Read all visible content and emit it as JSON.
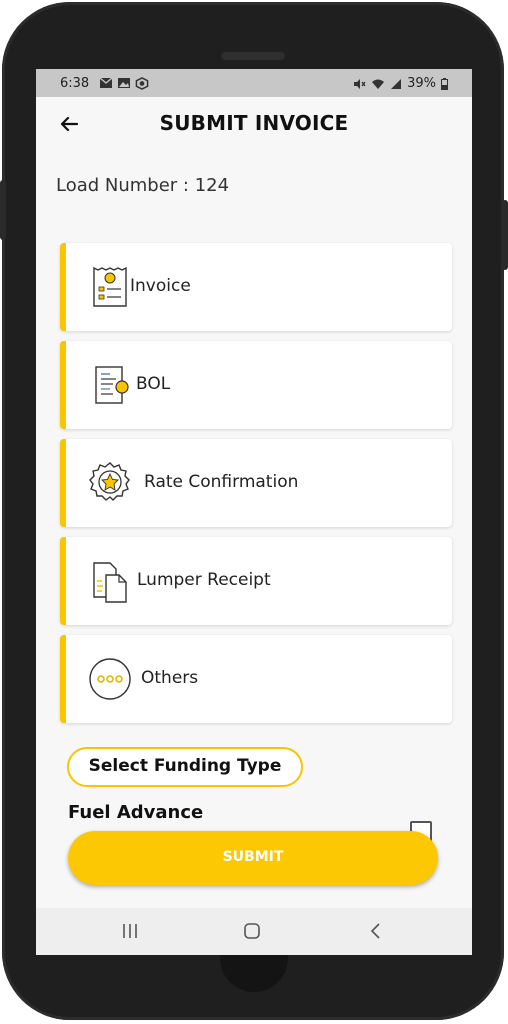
{
  "status_bar": {
    "time": "6:38",
    "battery": "39%",
    "left_icons": [
      "mail-icon",
      "image-icon",
      "vpn-shield-icon"
    ],
    "right_icons": [
      "mute-icon",
      "wifi-icon",
      "signal-icon",
      "battery-icon"
    ]
  },
  "header": {
    "title": "SUBMIT INVOICE",
    "back_icon": "back-arrow-icon"
  },
  "load": {
    "label": "Load Number : 124"
  },
  "documents": [
    {
      "label": "Invoice",
      "icon": "invoice-receipt-icon"
    },
    {
      "label": "BOL",
      "icon": "bol-document-icon"
    },
    {
      "label": "Rate Confirmation",
      "icon": "badge-star-icon"
    },
    {
      "label": "Lumper Receipt",
      "icon": "files-icon"
    },
    {
      "label": "Others",
      "icon": "more-dots-icon"
    }
  ],
  "funding": {
    "select_label": "Select Funding Type",
    "option_label": "Fuel Advance",
    "option_checked": false
  },
  "submit_label": "SUBMIT",
  "nav_bar": {
    "icons": [
      "recents-icon",
      "home-icon",
      "back-nav-icon"
    ]
  },
  "colors": {
    "accent": "#f7c600",
    "submit_bg": "#fcc803",
    "screen_bg": "#f7f7f7",
    "phone_body": "#1f1f1f"
  }
}
